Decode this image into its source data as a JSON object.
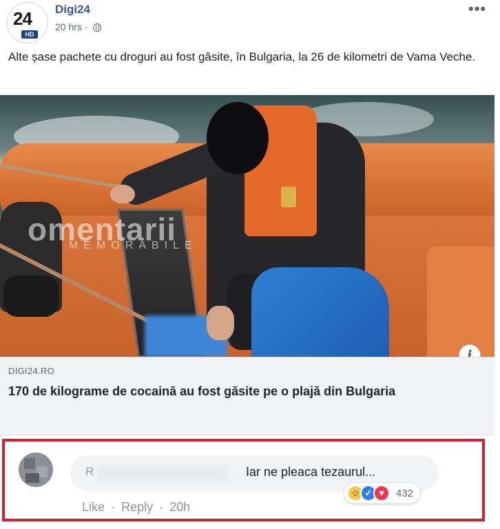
{
  "post": {
    "page_name": "Digi24",
    "avatar_text": "24",
    "avatar_badge": "HD",
    "time": "20 hrs",
    "more": "•••",
    "text": "Alte șase pachete cu droguri au fost găsite, în Bulgaria, la 26 de kilometri de Vama Veche."
  },
  "image": {
    "watermark": "omentarii",
    "watermark_sub": "MEMORABILE",
    "info_icon": "i"
  },
  "link": {
    "domain": "DIGI24.RO",
    "title": "170 de kilograme de cocaină au fost găsite pe o plajă din Bulgaria"
  },
  "comment": {
    "initial": "R",
    "text": "Iar ne pleaca tezaurul...",
    "reactions": [
      "haha-icon",
      "like-icon",
      "love-icon"
    ],
    "reaction_count": "432",
    "like_label": "Like",
    "reply_label": "Reply",
    "time": "20h",
    "sep": "·"
  },
  "colors": {
    "page_name": "#385898",
    "highlight_frame": "#cd2232",
    "link_box": "#f2f3f5"
  }
}
